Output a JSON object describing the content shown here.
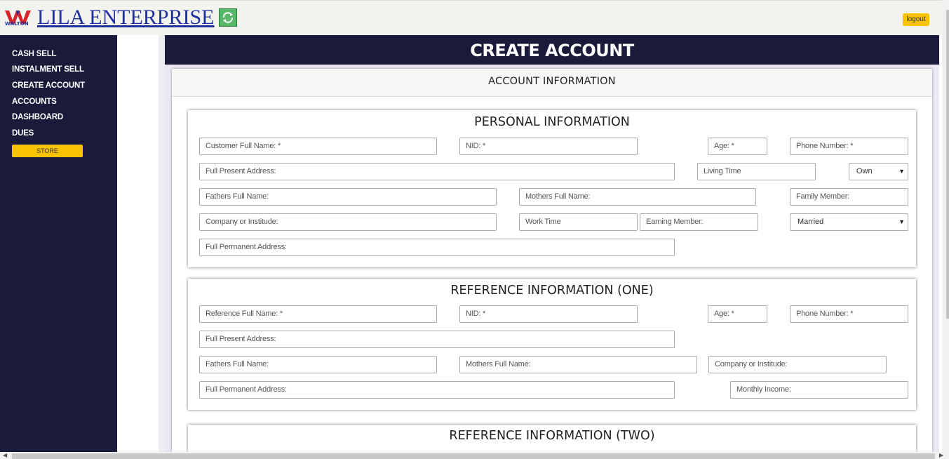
{
  "header": {
    "logo_text": "WALTON",
    "brand": "LILA ENTERPRISE",
    "logout_label": "logout"
  },
  "sidebar": {
    "items": [
      {
        "label": "CASH SELL"
      },
      {
        "label": "INSTALMENT SELL"
      },
      {
        "label": "CREATE ACCOUNT"
      },
      {
        "label": "ACCOUNTS"
      },
      {
        "label": "DASHBOARD"
      },
      {
        "label": "DUES"
      }
    ],
    "store_label": "STORE"
  },
  "main": {
    "title": "CREATE ACCOUNT",
    "card_header": "ACCOUNT INFORMATION"
  },
  "personal": {
    "title": "PERSONAL INFORMATION",
    "customer_name": "Customer Full Name: *",
    "nid": "NID: *",
    "age": "Age: *",
    "phone": "Phone Number: *",
    "present_address": "Full Present Address:",
    "living_time": "Living Time",
    "ownership_value": "Own",
    "fathers_name": "Fathers Full Name:",
    "mothers_name": "Mothers Full Name:",
    "family_member": "Family Member:",
    "company": "Company or Institude:",
    "work_time": "Work Time",
    "earning_member": "Earning Member:",
    "marital_value": "Married",
    "permanent_address": "Full Permanent Address:"
  },
  "reference_one": {
    "title": "REFERENCE INFORMATION (ONE)",
    "reference_name": "Reference Full Name: *",
    "nid": "NID: *",
    "age": "Age: *",
    "phone": "Phone Number: *",
    "present_address": "Full Present Address:",
    "fathers_name": "Fathers Full Name:",
    "mothers_name": "Mothers Full Name:",
    "company": "Company or Institude:",
    "permanent_address": "Full Permanent Address:",
    "monthly_income": "Monthly Income:"
  },
  "reference_two": {
    "title": "REFERENCE INFORMATION (TWO)"
  },
  "colors": {
    "navy": "#1a1a3a",
    "accent": "#f8c300",
    "brand_blue": "#1f2f9c"
  }
}
